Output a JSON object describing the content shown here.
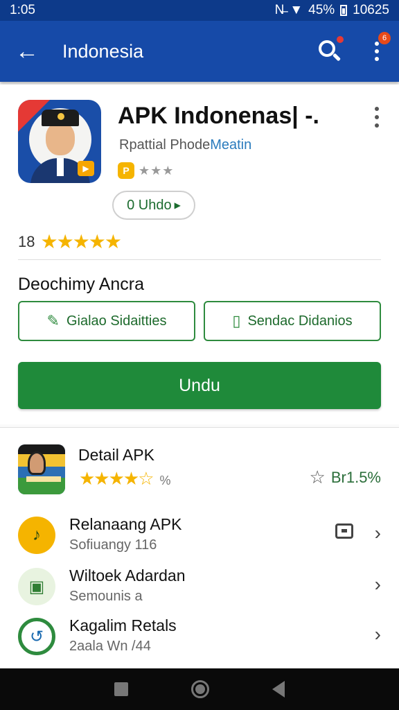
{
  "status_bar": {
    "time": "1:05",
    "battery": "45%",
    "extra": "10625"
  },
  "app_bar": {
    "title": "Indonesia",
    "more_badge": "6"
  },
  "app": {
    "title": "APK Indonenas| -.",
    "developer_prefix": "Rpattial Phode",
    "developer_link": "Meatin",
    "badge": "P",
    "small_stars": "★★★",
    "unduh_pill": "0 Uhdo",
    "review_count": "18",
    "stars": "★★★★★"
  },
  "section": {
    "title": "Deochimy Ancra",
    "button_left": "Gialao Sidaitties",
    "button_right": "Sendac Didanios",
    "primary": "Undu"
  },
  "detail": {
    "title": "Detail APK",
    "stars": "★★★★☆",
    "sub": "%",
    "right_value": "Br1.5%"
  },
  "list": [
    {
      "title": "Relanaang APK",
      "sub": "Sofiuangy 116",
      "icon": "music-note-icon",
      "color": "#f5b400"
    },
    {
      "title": "Wiltoek Adardan",
      "sub": "Semounis a",
      "icon": "calendar-icon",
      "color": "#e8f3e0"
    },
    {
      "title": "Kagalim Retals",
      "sub": "2aala Wn /44",
      "icon": "refresh-icon",
      "color": "#ffffff"
    }
  ],
  "colors": {
    "app_bar": "#164aa8",
    "status_bar": "#0d3a8a",
    "primary_green": "#1f8a3a",
    "star": "#f5b400"
  }
}
